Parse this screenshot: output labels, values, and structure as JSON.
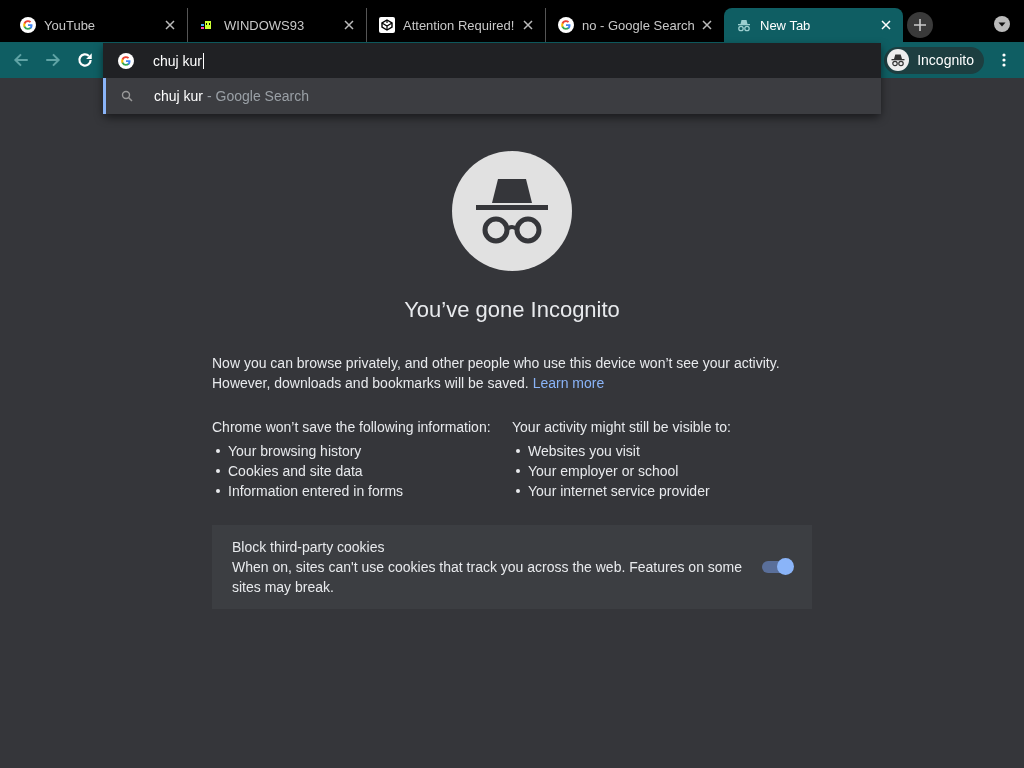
{
  "tabs": [
    {
      "title": "YouTube",
      "kind": "google",
      "selected": false
    },
    {
      "title": "WINDOWS93",
      "kind": "windows93",
      "selected": false
    },
    {
      "title": "Attention Required!",
      "kind": "cube",
      "selected": false
    },
    {
      "title": "no - Google Search",
      "kind": "google",
      "selected": false
    },
    {
      "title": "New Tab",
      "kind": "incognito",
      "selected": true
    }
  ],
  "omnibox": {
    "value": "chuj kur",
    "suggestions": [
      {
        "query": "chuj kur",
        "suffix": "- Google Search",
        "selected": true
      }
    ]
  },
  "profile": {
    "label": "Incognito"
  },
  "page": {
    "heading": "You’ve gone Incognito",
    "intro": "Now you can browse privately, and other people who use this device won’t see your activity. However, downloads and bookmarks will be saved.",
    "link": "Learn more",
    "columns": [
      {
        "heading": "Chrome won’t save the following information:",
        "items": [
          "Your browsing history",
          "Cookies and site data",
          "Information entered in forms"
        ]
      },
      {
        "heading": "Your activity might still be visible to:",
        "items": [
          "Websites you visit",
          "Your employer or school",
          "Your internet service provider"
        ]
      }
    ],
    "cookies": {
      "title": "Block third-party cookies",
      "description": "When on, sites can't use cookies that track you across the web. Features on some sites may break.",
      "on": true
    }
  }
}
